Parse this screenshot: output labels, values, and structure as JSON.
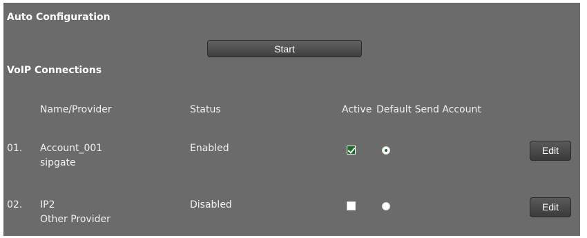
{
  "auto_config": {
    "title": "Auto Configuration",
    "start_label": "Start"
  },
  "voip": {
    "title": "VoIP Connections",
    "headers": {
      "name": "Name/Provider",
      "status": "Status",
      "active": "Active",
      "default": "Default Send Account"
    },
    "rows": [
      {
        "num": "01.",
        "name": "Account_001",
        "provider": "sipgate",
        "status": "Enabled",
        "active": true,
        "default_send": true,
        "edit_label": "Edit"
      },
      {
        "num": "02.",
        "name": "IP2",
        "provider": "Other Provider",
        "status": "Disabled",
        "active": false,
        "default_send": false,
        "edit_label": "Edit"
      }
    ]
  },
  "colors": {
    "panel_bg": "#6b6b6b",
    "accent_green": "#1c6b26",
    "button_dark": "#3e3e3e"
  }
}
